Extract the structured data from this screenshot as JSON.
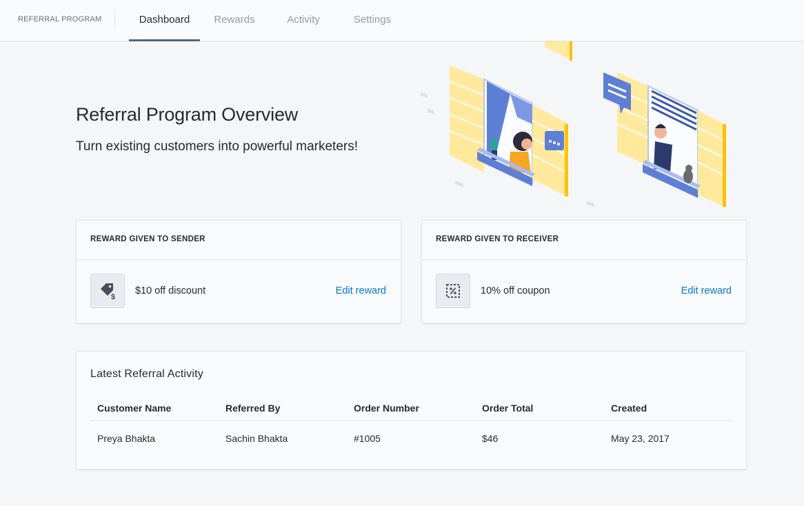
{
  "nav": {
    "brand": "REFERRAL PROGRAM",
    "tabs": [
      {
        "label": "Dashboard",
        "active": true
      },
      {
        "label": "Rewards",
        "active": false
      },
      {
        "label": "Activity",
        "active": false
      },
      {
        "label": "Settings",
        "active": false
      }
    ]
  },
  "hero": {
    "title": "Referral Program Overview",
    "subtitle": "Turn existing customers into powerful marketers!"
  },
  "sender_card": {
    "heading": "REWARD GIVEN TO SENDER",
    "icon": "price-tag-dollar-icon",
    "reward": "$10 off discount",
    "edit_label": "Edit reward"
  },
  "receiver_card": {
    "heading": "REWARD GIVEN TO RECEIVER",
    "icon": "percent-coupon-icon",
    "reward": "10% off coupon",
    "edit_label": "Edit reward"
  },
  "activity": {
    "title": "Latest Referral Activity",
    "columns": [
      "Customer Name",
      "Referred By",
      "Order Number",
      "Order Total",
      "Created"
    ],
    "rows": [
      {
        "customer": "Preya Bhakta",
        "referred_by": "Sachin Bhakta",
        "order_number": "#1005",
        "order_total": "$46",
        "created": "May 23, 2017"
      }
    ]
  },
  "colors": {
    "link": "#007ace",
    "accent_yellow": "#ffe58f",
    "accent_blue": "#5c7fd6"
  }
}
